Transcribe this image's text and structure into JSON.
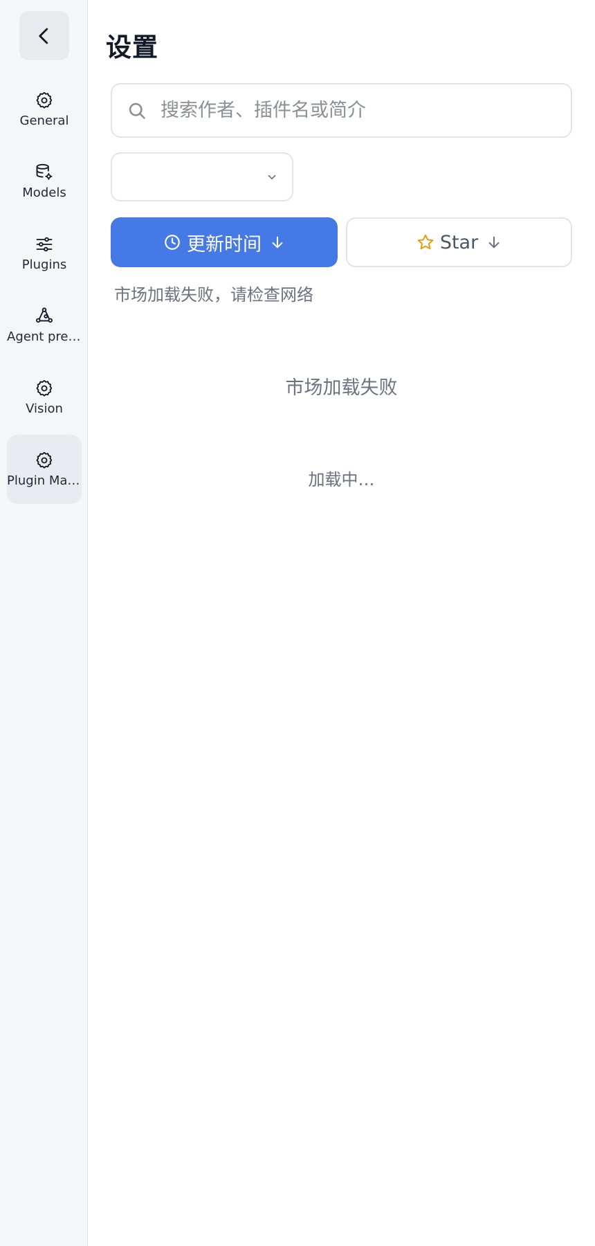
{
  "sidebar": {
    "back_label": "",
    "items": [
      {
        "label": "General",
        "icon": "gear-icon",
        "active": false
      },
      {
        "label": "Models",
        "icon": "database-gear-icon",
        "active": false
      },
      {
        "label": "Plugins",
        "icon": "sliders-icon",
        "active": false
      },
      {
        "label": "Agent pres…",
        "icon": "agent-network-icon",
        "active": false
      },
      {
        "label": "Vision",
        "icon": "gear-icon",
        "active": false
      },
      {
        "label": "Plugin Mar…",
        "icon": "gear-icon",
        "active": true
      }
    ]
  },
  "main": {
    "title": "设置",
    "search": {
      "placeholder": "搜索作者、插件名或简介",
      "value": ""
    },
    "select": {
      "value": ""
    },
    "sort": {
      "primary_label": "更新时间",
      "secondary_label": "Star"
    },
    "error_message": "市场加载失败，请检查网络",
    "center_error": "市场加载失败",
    "loading": "加载中…"
  },
  "colors": {
    "accent": "#4479e6",
    "star": "#e0a21a",
    "sidebar_bg": "#f4f6f8"
  }
}
